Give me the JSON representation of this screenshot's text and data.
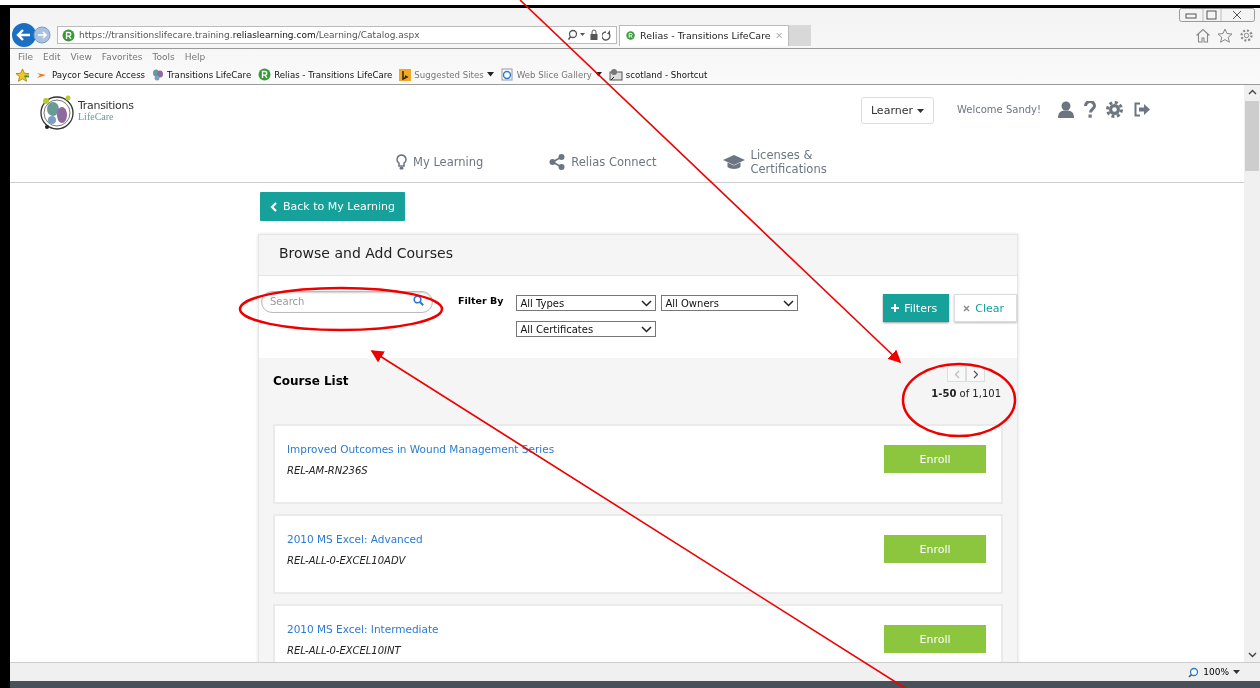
{
  "browser": {
    "url_host_pre": "https://transitionslifecare.training.",
    "url_host_bold": "reliaslearning.com",
    "url_path": "/Learning/Catalog.aspx",
    "tab_title": "Relias - Transitions LifeCare",
    "menu": [
      "File",
      "Edit",
      "View",
      "Favorites",
      "Tools",
      "Help"
    ],
    "favorites": [
      {
        "label": "Paycor Secure Access",
        "kind": "arrow",
        "dropdown": false
      },
      {
        "label": "Transitions LifeCare",
        "kind": "butterfly",
        "dropdown": false
      },
      {
        "label": "Relias - Transitions LifeCare",
        "kind": "relias",
        "dropdown": false
      },
      {
        "label": "Suggested Sites",
        "kind": "bing",
        "dropdown": true
      },
      {
        "label": "Web Slice Gallery",
        "kind": "ie",
        "dropdown": true
      },
      {
        "label": "scotland - Shortcut",
        "kind": "shortcut",
        "dropdown": false
      }
    ],
    "zoom": "100%"
  },
  "header": {
    "logo_name": "Transitions",
    "logo_sub": "LifeCare",
    "role_button": "Learner",
    "welcome": "Welcome Sandy!",
    "nav": [
      {
        "label": "My Learning",
        "kind": "bulb"
      },
      {
        "label": "Relias Connect",
        "kind": "share"
      },
      {
        "label": "Licenses & Certifications",
        "kind": "cap"
      }
    ]
  },
  "back_button": "Back to My Learning",
  "panel": {
    "title": "Browse and Add Courses",
    "search_placeholder": "Search",
    "filter_label": "Filter By",
    "selects": [
      "All Types",
      "All Owners",
      "All Certificates"
    ],
    "filters_button": "Filters",
    "clear_button": "Clear",
    "list_title": "Course List",
    "pagination": "**1-50** of 1,101",
    "courses": [
      {
        "title": "Improved Outcomes in Wound Management Series",
        "code": "REL-AM-RN236S",
        "button": "Enroll"
      },
      {
        "title": "2010 MS Excel: Advanced",
        "code": "REL-ALL-0-EXCEL10ADV",
        "button": "Enroll"
      },
      {
        "title": "2010 MS Excel: Intermediate",
        "code": "REL-ALL-0-EXCEL10INT",
        "button": "Enroll"
      }
    ]
  }
}
